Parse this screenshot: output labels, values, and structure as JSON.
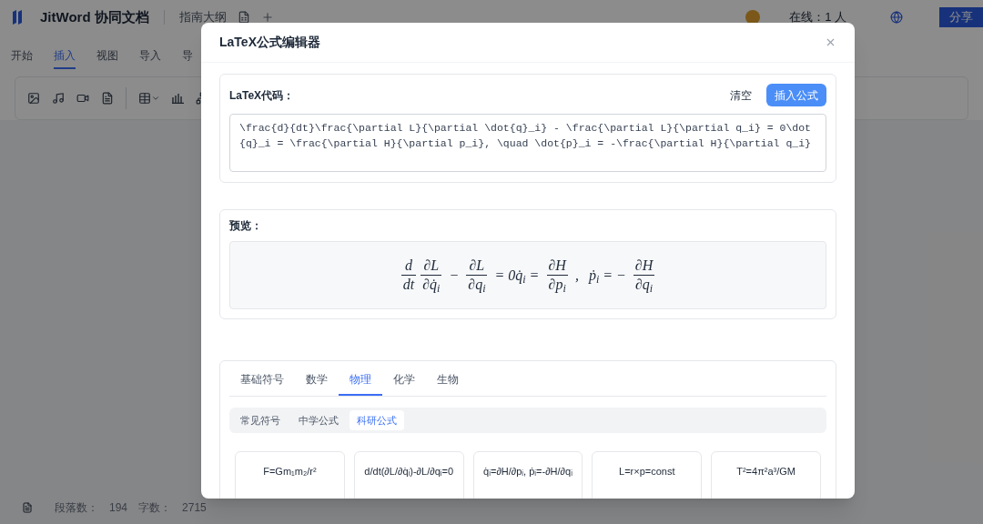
{
  "app": {
    "name": "JitWord 协同文档",
    "doc_title": "指南大纲",
    "online": "在线：1 人",
    "share_button": "分享"
  },
  "ribbon_tabs": [
    {
      "label": "开始",
      "selected": false
    },
    {
      "label": "插入",
      "selected": true
    },
    {
      "label": "视图",
      "selected": false
    },
    {
      "label": "导入",
      "selected": false
    },
    {
      "label": "导",
      "selected": false
    }
  ],
  "toolbar": [
    {
      "kind": "image"
    },
    {
      "kind": "music"
    },
    {
      "kind": "video"
    },
    {
      "kind": "doc"
    },
    {
      "kind": "divider"
    },
    {
      "kind": "table"
    },
    {
      "kind": "chart"
    },
    {
      "kind": "graph"
    }
  ],
  "status_bar": [
    {
      "label": "段落数：",
      "value": "194"
    },
    {
      "label": "字数：",
      "value": "2715"
    }
  ],
  "dialog": {
    "title": "LaTeX公式编辑器",
    "code_label": "LaTeX代码：",
    "clear_button": "清空",
    "insert_button": "插入公式",
    "latex_code": "\\frac{d}{dt}\\frac{\\partial L}{\\partial \\dot{q}_i} - \\frac{\\partial L}{\\partial q_i} = 0\\dot{q}_i = \\frac{\\partial H}{\\partial p_i}, \\quad \\dot{p}_i = -\\frac{\\partial H}{\\partial q_i}",
    "preview_label": "预览：",
    "preview": [
      {
        "kind": "frac",
        "num": "d",
        "den": "dt"
      },
      {
        "kind": "frac",
        "num": "∂L",
        "den": "∂q̇$_{i}$"
      },
      {
        "kind": "op",
        "text": "−"
      },
      {
        "kind": "frac",
        "num": "∂L",
        "den": "∂q$_{i}$"
      },
      {
        "kind": "op",
        "text": "= 0q̇$_{i}$ ="
      },
      {
        "kind": "frac",
        "num": "∂H",
        "den": "∂p$_{i}$"
      },
      {
        "kind": "op",
        "text": ","
      },
      {
        "kind": "op",
        "text": "ṗ$_{i}$ = −"
      },
      {
        "kind": "frac",
        "num": "∂H",
        "den": "∂q$_{i}$"
      }
    ],
    "category_tabs": [
      {
        "label": "基础符号",
        "selected": false
      },
      {
        "label": "数学",
        "selected": false
      },
      {
        "label": "物理",
        "selected": true
      },
      {
        "label": "化学",
        "selected": false
      },
      {
        "label": "生物",
        "selected": false
      }
    ],
    "sub_tabs": [
      {
        "label": "常见符号",
        "selected": false
      },
      {
        "label": "中学公式",
        "selected": false
      },
      {
        "label": "科研公式",
        "selected": true
      }
    ],
    "formulas": [
      "F=Gm₁m₂/r²",
      "d/dt(∂L/∂q̇ᵢ)-∂L/∂qᵢ=0",
      "q̇ᵢ=∂H/∂pᵢ, ṗᵢ=-∂H/∂qᵢ",
      "L=r×p=const",
      "T²=4π²a³/GM"
    ]
  }
}
